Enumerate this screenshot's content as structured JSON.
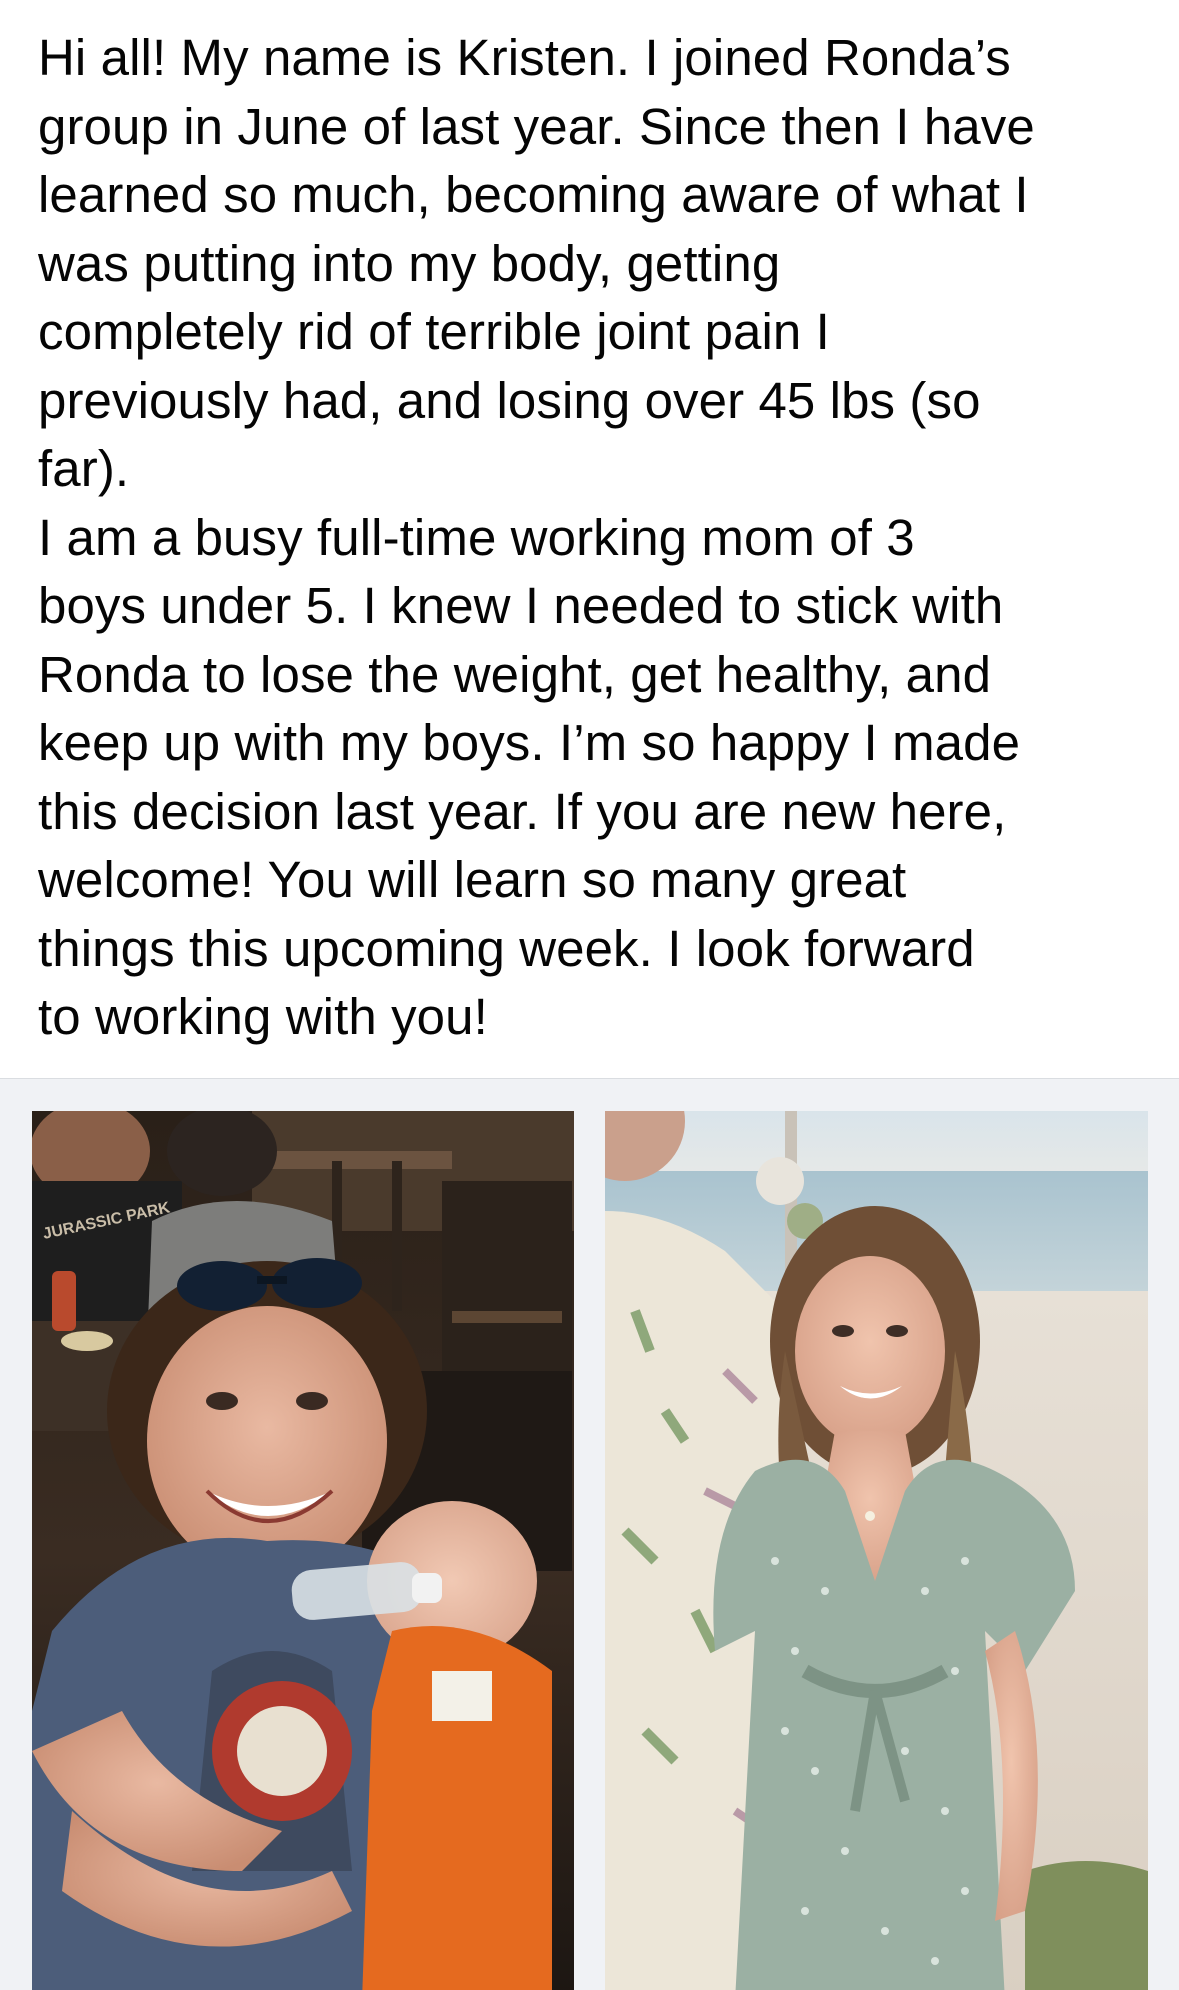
{
  "post": {
    "lines": [
      "Hi all! My name is Kristen. I joined Ronda’s",
      "group in June of last year. Since then I have",
      "learned so much, becoming aware of what I",
      "was putting into my body, getting",
      "completely rid of terrible joint pain I",
      "previously had, and losing over 45 lbs (so",
      "far).",
      "I am a busy full-time working mom of 3",
      "boys under 5. I knew I needed to stick with",
      "Ronda to lose the weight, get healthy, and",
      "keep up with my boys. I’m so happy I made",
      "this decision last year. If you are new here,",
      "welcome! You will learn so many great",
      "things this upcoming week. I look forward",
      "to working with you!"
    ]
  },
  "photos": {
    "before": {
      "shirt_text": "JURASSIC PARK"
    },
    "after": {}
  },
  "colors": {
    "text": "#050505",
    "strip_background": "#f0f2f5"
  }
}
